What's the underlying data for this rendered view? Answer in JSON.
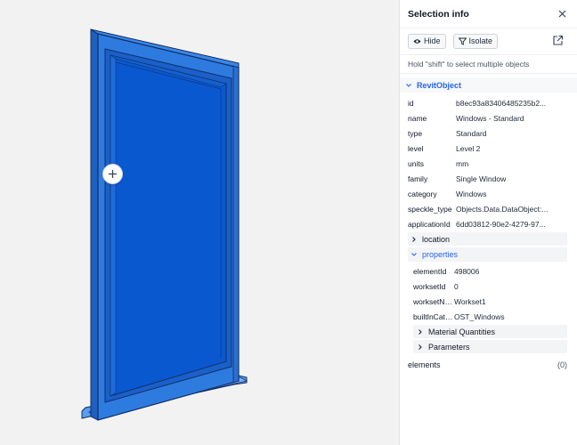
{
  "panel": {
    "title": "Selection info",
    "hide_label": "Hide",
    "isolate_label": "Isolate",
    "hint": "Hold \"shift\" to select multiple objects",
    "section_title": "RevitObject",
    "fields": [
      {
        "key": "id",
        "value": "b8ec93a83406485235b2..."
      },
      {
        "key": "name",
        "value": "Windows - Standard"
      },
      {
        "key": "type",
        "value": "Standard"
      },
      {
        "key": "level",
        "value": "Level 2"
      },
      {
        "key": "units",
        "value": "mm"
      },
      {
        "key": "family",
        "value": "Single Window"
      },
      {
        "key": "category",
        "value": "Windows"
      },
      {
        "key": "speckle_type",
        "value": "Objects.Data.DataObject:..."
      },
      {
        "key": "applicationId",
        "value": "6dd03812-90e2-4279-97..."
      }
    ],
    "location_label": "location",
    "properties_label": "properties",
    "properties_fields": [
      {
        "key": "elementId",
        "value": "498006"
      },
      {
        "key": "worksetId",
        "value": "0"
      },
      {
        "key": "worksetNa...",
        "value": "Workset1"
      },
      {
        "key": "builtInCate...",
        "value": "OST_Windows"
      }
    ],
    "material_quantities_label": "Material Quantities",
    "parameters_label": "Parameters",
    "elements_label": "elements",
    "elements_count": "(0)"
  },
  "icons": {
    "close": "close-icon",
    "hide": "eye-icon",
    "isolate": "filter-icon",
    "open_external": "external-link-icon",
    "add": "plus-icon",
    "chevron_down": "chevron-down-icon",
    "chevron_right": "chevron-right-icon"
  },
  "colors": {
    "accent": "#2563eb",
    "window_blue": "#0b5fd1",
    "frame_blue": "#2f7de0"
  }
}
